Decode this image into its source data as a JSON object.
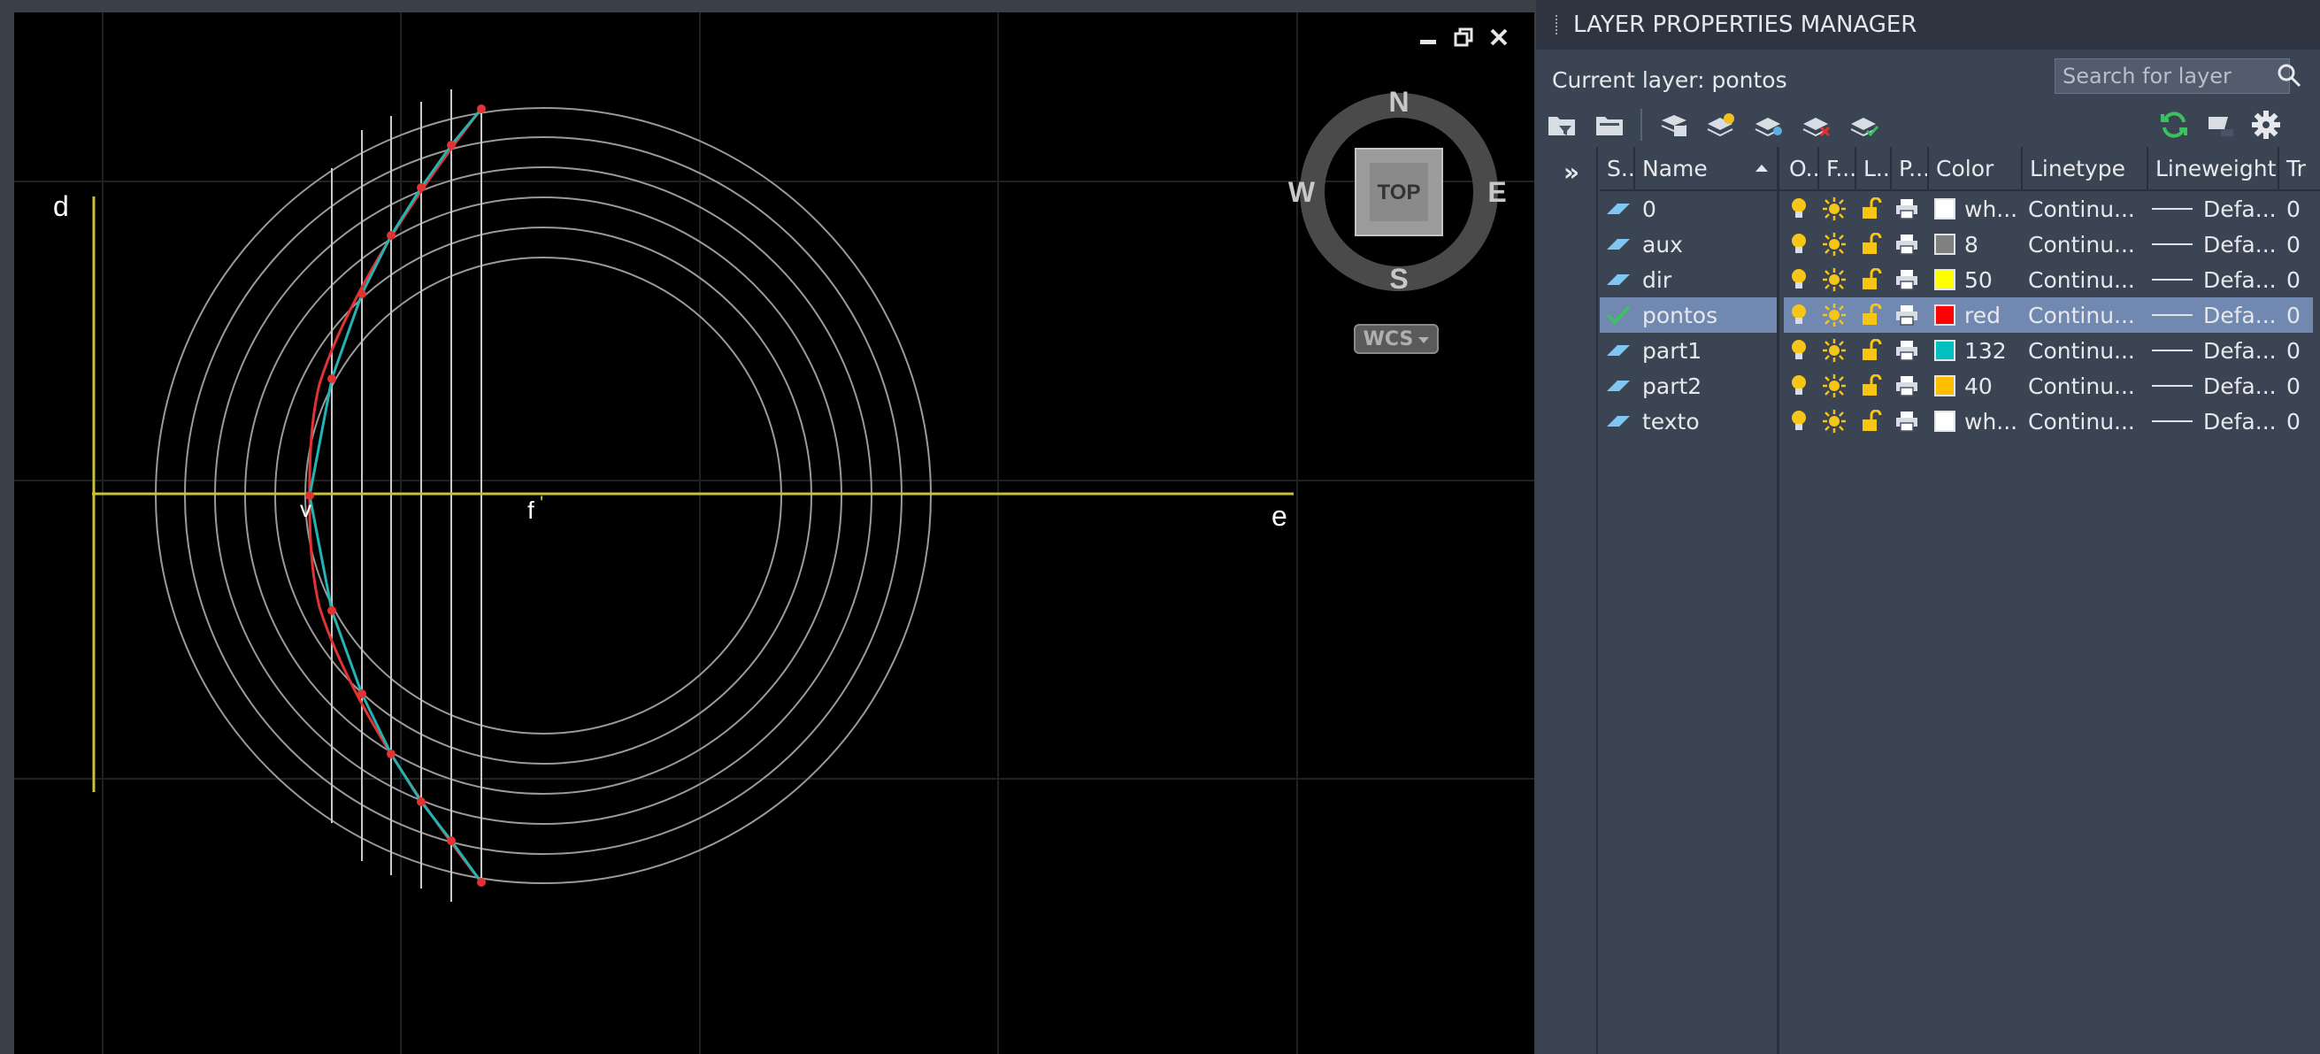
{
  "viewport": {
    "labels": {
      "d": "d",
      "v": "v",
      "f": "f",
      "e": "e",
      "f_tick": "'"
    },
    "controls": [
      "minimize-icon",
      "restore-icon",
      "close-icon"
    ],
    "colors": {
      "background": "#000000",
      "axis": "#c8c23a",
      "circles": "#9a9a9a",
      "parabola": "#e23333",
      "polyline": "#24b3b3",
      "points": "#e23333"
    },
    "viewcube": {
      "face": "TOP",
      "north": "N",
      "south": "S",
      "east": "E",
      "west": "W"
    },
    "wcs": {
      "label": "WCS"
    }
  },
  "palette": {
    "title": "LAYER PROPERTIES MANAGER",
    "current_layer": "Current layer: pontos",
    "search": {
      "placeholder": "Search for layer"
    },
    "toolbar_icons": [
      "new-property-filter-icon",
      "new-group-filter-icon",
      "layer-states-manager-icon",
      "new-layer-icon",
      "new-layer-vp-frozen-icon",
      "delete-layer-icon",
      "set-current-icon",
      "refresh-icon",
      "settings-menu-icon",
      "gear-icon"
    ],
    "expand_label": "»",
    "columns": [
      "S...",
      "Name",
      "O...",
      "F...",
      "L...",
      "P...",
      "Color",
      "Linetype",
      "Lineweight",
      "Tr"
    ],
    "layers": [
      {
        "name": "0",
        "color_name": "wh...",
        "color_hex": "#ffffff",
        "linetype": "Continu...",
        "lineweight": "Defa...",
        "transparency": "0",
        "current": false
      },
      {
        "name": "aux",
        "color_name": "8",
        "color_hex": "#808080",
        "linetype": "Continu...",
        "lineweight": "Defa...",
        "transparency": "0",
        "current": false
      },
      {
        "name": "dir",
        "color_name": "50",
        "color_hex": "#ffff00",
        "linetype": "Continu...",
        "lineweight": "Defa...",
        "transparency": "0",
        "current": false
      },
      {
        "name": "pontos",
        "color_name": "red",
        "color_hex": "#ff0000",
        "linetype": "Continu...",
        "lineweight": "Defa...",
        "transparency": "0",
        "current": true
      },
      {
        "name": "part1",
        "color_name": "132",
        "color_hex": "#00bfbf",
        "linetype": "Continu...",
        "lineweight": "Defa...",
        "transparency": "0",
        "current": false
      },
      {
        "name": "part2",
        "color_name": "40",
        "color_hex": "#ffbf00",
        "linetype": "Continu...",
        "lineweight": "Defa...",
        "transparency": "0",
        "current": false
      },
      {
        "name": "texto",
        "color_name": "wh...",
        "color_hex": "#ffffff",
        "linetype": "Continu...",
        "lineweight": "Defa...",
        "transparency": "0",
        "current": false
      }
    ],
    "colors": {
      "panel": "#3b4453",
      "title_bar": "#2e3440",
      "selected_row": "#7189b0",
      "text": "#e6e8ec"
    }
  }
}
